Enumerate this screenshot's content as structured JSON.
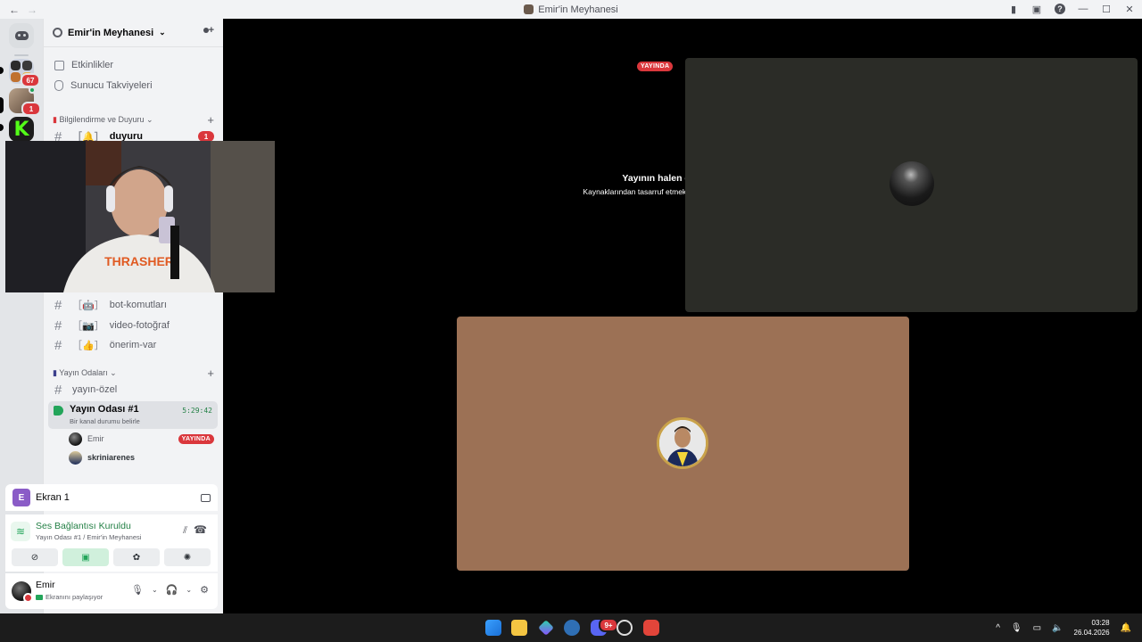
{
  "window": {
    "title": "Emir'in Meyhanesi",
    "back": "←",
    "forward": "→",
    "controls": [
      "—",
      "☐",
      "✕"
    ]
  },
  "server": {
    "name": "Emir'in Meyhanesi",
    "rail_badges": {
      "folder": "67",
      "second": "1"
    }
  },
  "sidebar": {
    "top_items": [
      {
        "label": "Etkinlikler"
      },
      {
        "label": "Sunucu Takviyeleri"
      }
    ],
    "categories": {
      "announce": "Bilgilendirme ve Duyuru",
      "stream": "Yayın Odaları"
    },
    "channels": {
      "duyuru": {
        "emoji": "［🔔］",
        "label": "duyuru",
        "badge": "1"
      },
      "bot": {
        "emoji": "［🤖］",
        "label": "bot-komutları"
      },
      "video": {
        "emoji": "［📷］",
        "label": "video-fotoğraf"
      },
      "onerim": {
        "emoji": "［👍］",
        "label": "önerim-var"
      },
      "yayin_ozel": {
        "label": "yayın-özel"
      }
    },
    "voice_channel": {
      "name": "Yayın Odası #1",
      "status": "Bir kanal durumu belirle",
      "timer": "5:29:42",
      "users": [
        {
          "name": "Emir",
          "badge": "YAYINDA"
        },
        {
          "name": "skriniarenes"
        }
      ]
    }
  },
  "panels": {
    "screen": {
      "icon_letter": "E",
      "label": "Ekran 1"
    },
    "voice": {
      "status": "Ses Bağlantısı Kuruldu",
      "location": "Yayın Odası #1 / Emir'in Meyhanesi"
    },
    "user": {
      "name": "Emir",
      "status": "Ekranını paylaşıyor"
    }
  },
  "stage": {
    "live_badge": "YAYINDA",
    "paused_title": "Yayının halen devam ediyor!",
    "paused_sub": "Kaynaklarından tasarruf etmek için bu önizlemeyi duraklattık."
  },
  "taskbar": {
    "time": "03:28",
    "date": "26.04.2026",
    "discord_badge": "9+"
  },
  "colors": {
    "live": "#da373c",
    "voice_green": "#23a55a",
    "tile_dark": "#2b2c27",
    "tile_brown": "#9c7155"
  }
}
